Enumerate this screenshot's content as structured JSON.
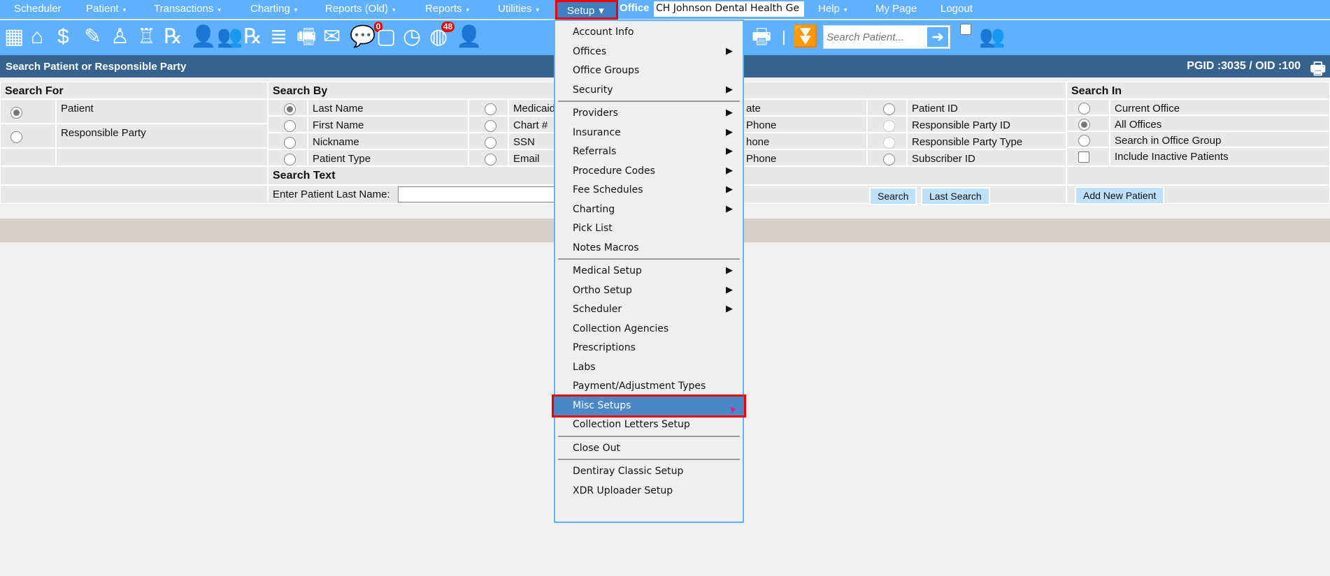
{
  "nav": {
    "items": [
      {
        "label": "Scheduler",
        "dropdown": false
      },
      {
        "label": "Patient",
        "dropdown": true
      },
      {
        "label": "Transactions",
        "dropdown": true
      },
      {
        "label": "Charting",
        "dropdown": true
      },
      {
        "label": "Reports (Old)",
        "dropdown": true
      },
      {
        "label": "Reports",
        "dropdown": true
      },
      {
        "label": "Utilities",
        "dropdown": true
      }
    ],
    "setup": "Setup",
    "office_label": "Office",
    "office_value": "CH Johnson Dental Health Ge",
    "help": "Help",
    "mypage": "My Page",
    "logout": "Logout",
    "caret": "▾"
  },
  "toolbar": {
    "messages_badge": "0",
    "notifications_badge": "48",
    "search_placeholder": "Search Patient..."
  },
  "header": {
    "title": "Search Patient or Responsible Party",
    "ids": "PGID :3035  /  OID :100"
  },
  "search_for": {
    "title": "Search For",
    "options": [
      {
        "label": "Patient",
        "checked": true
      },
      {
        "label": "Responsible Party",
        "checked": false
      }
    ]
  },
  "search_by": {
    "title": "Search By",
    "col1": [
      {
        "label": "Last Name",
        "checked": true
      },
      {
        "label": "First Name"
      },
      {
        "label": "Nickname"
      },
      {
        "label": "Patient Type"
      }
    ],
    "col2": [
      {
        "label": "Medicaid"
      },
      {
        "label": "Chart #"
      },
      {
        "label": "SSN"
      },
      {
        "label": "Email"
      }
    ],
    "col3": [
      {
        "label": "ate"
      },
      {
        "label": "Phone"
      },
      {
        "label": "hone"
      },
      {
        "label": "Phone"
      }
    ],
    "col4": [
      {
        "label": "Patient ID"
      },
      {
        "label": "Responsible Party ID",
        "disabled": true
      },
      {
        "label": "Responsible Party Type",
        "disabled": true
      },
      {
        "label": "Subscriber ID"
      }
    ],
    "search_text_title": "Search Text",
    "input_label": "Enter Patient Last Name:",
    "input_value": "",
    "search_btn": "Search",
    "last_search_btn": "Last Search"
  },
  "search_in": {
    "title": "Search In",
    "options": [
      {
        "label": "Current Office"
      },
      {
        "label": "All Offices",
        "checked": true
      },
      {
        "label": "Search in Office Group"
      }
    ],
    "inactive_label": "Include Inactive Patients",
    "add_btn": "Add New Patient"
  },
  "setup_menu": {
    "items": [
      {
        "label": "Account Info"
      },
      {
        "label": "Offices",
        "sub": true
      },
      {
        "label": "Office Groups"
      },
      {
        "label": "Security",
        "sub": true,
        "sep_after": true
      },
      {
        "label": "Providers",
        "sub": true
      },
      {
        "label": "Insurance",
        "sub": true
      },
      {
        "label": "Referrals",
        "sub": true
      },
      {
        "label": "Procedure Codes",
        "sub": true
      },
      {
        "label": "Fee Schedules",
        "sub": true
      },
      {
        "label": "Charting",
        "sub": true
      },
      {
        "label": "Pick List"
      },
      {
        "label": "Notes Macros",
        "sep_after": true
      },
      {
        "label": "Medical Setup",
        "sub": true
      },
      {
        "label": "Ortho Setup",
        "sub": true
      },
      {
        "label": "Scheduler",
        "sub": true
      },
      {
        "label": "Collection Agencies"
      },
      {
        "label": "Prescriptions"
      },
      {
        "label": "Labs"
      },
      {
        "label": "Payment/Adjustment Types"
      },
      {
        "label": "Misc Setups",
        "selected": true
      },
      {
        "label": "Collection Letters Setup",
        "sep_after": true
      },
      {
        "label": "Close Out",
        "sep_after": true
      },
      {
        "label": "Dentiray Classic Setup"
      },
      {
        "label": "XDR Uploader Setup"
      }
    ]
  },
  "colors": {
    "nav": "#5fb0fd",
    "header": "#35638e",
    "highlight": "#4a88c8",
    "outline": "#ee0000"
  }
}
